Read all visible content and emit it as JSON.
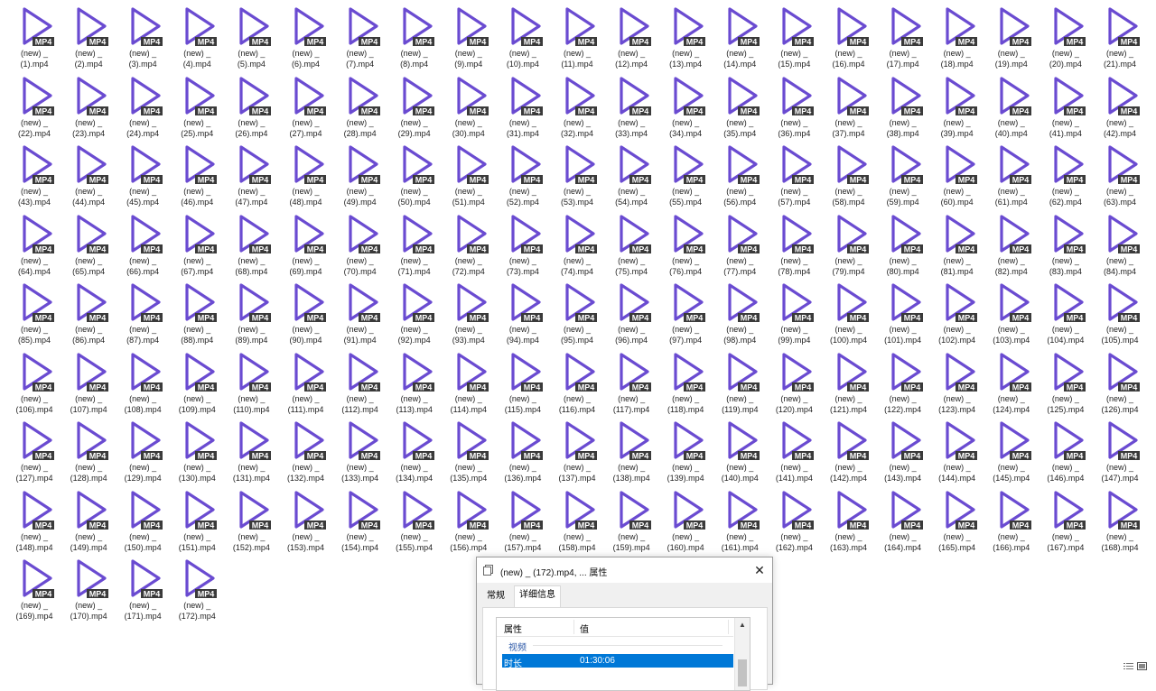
{
  "icon_name": "mp4-video-file-icon",
  "icon_badge": "MP4",
  "colors": {
    "play_triangle": "#6a4bd1",
    "badge_bg": "#3a3a3a",
    "badge_text": "#ffffff",
    "selection": "#0078d7",
    "group_header": "#2e5aa8"
  },
  "grid": {
    "columns": 21,
    "total_files": 172
  },
  "files": [],
  "dialog": {
    "title": "(new) _ (172).mp4, ... 属性",
    "close_label": "✕",
    "tabs": [
      "常规",
      "详细信息"
    ],
    "active_tab": "详细信息",
    "columns": [
      "属性",
      "值"
    ],
    "group": "视频",
    "selected_row": {
      "key": "时长",
      "value": "01:30:06"
    },
    "scroll_up_glyph": "▲"
  }
}
